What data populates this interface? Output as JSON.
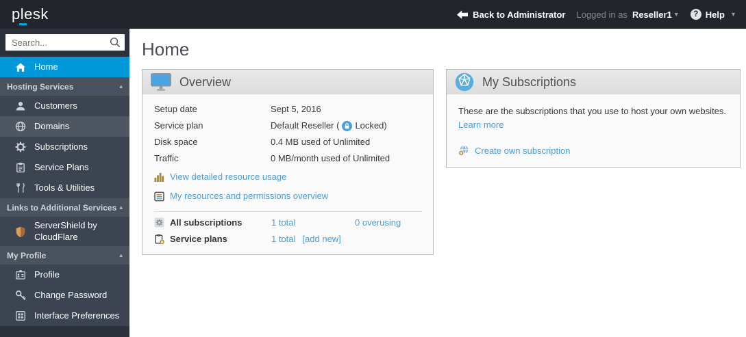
{
  "colors": {
    "topbar_bg": "#22262c",
    "accent_cyan": "#00a8e1",
    "active_item_bg": "#0098d8",
    "sidebar_bg": "#2b313b",
    "sidebar_item_bg": "#3b4450",
    "sidebar_section_bg": "#49525c",
    "link_blue": "#4a9ed8",
    "panel_header_bg": "#e4e4e4",
    "gold_icon": "#a5873d"
  },
  "glyphs": {
    "caret_down": "▾",
    "caret_up": "▴",
    "help_mark": "?"
  },
  "topbar": {
    "logo_text": "plesk",
    "back_label": "Back to Administrator",
    "logged_in_as_label": "Logged in as",
    "user_name": "Reseller1",
    "help_label": "Help"
  },
  "sidebar": {
    "search_placeholder": "Search...",
    "home_label": "Home",
    "sections": [
      {
        "label": "Hosting Services",
        "items": [
          {
            "label": "Customers"
          },
          {
            "label": "Domains"
          },
          {
            "label": "Subscriptions"
          },
          {
            "label": "Service Plans"
          },
          {
            "label": "Tools & Utilities"
          }
        ]
      },
      {
        "label": "Links to Additional Services",
        "items": [
          {
            "label": "ServerShield by CloudFlare"
          }
        ]
      },
      {
        "label": "My Profile",
        "items": [
          {
            "label": "Profile"
          },
          {
            "label": "Change Password"
          },
          {
            "label": "Interface Preferences"
          }
        ]
      }
    ]
  },
  "main": {
    "page_title": "Home",
    "overview": {
      "title": "Overview",
      "rows": [
        {
          "label": "Setup date",
          "value": "Sept 5, 2016"
        },
        {
          "label": "Service plan",
          "value_prefix": "Default Reseller (",
          "value_locked": "Locked)"
        },
        {
          "label": "Disk space",
          "value": "0.4 MB used of Unlimited"
        },
        {
          "label": "Traffic",
          "value": "0 MB/month used of Unlimited"
        }
      ],
      "links": [
        {
          "label": "View detailed resource usage"
        },
        {
          "label": "My resources and permissions overview"
        }
      ],
      "stats": [
        {
          "label": "All subscriptions",
          "total": "1 total",
          "extra": "0 overusing"
        },
        {
          "label": "Service plans",
          "total": "1 total",
          "extra": "[add new]"
        }
      ]
    },
    "my_subscriptions": {
      "title": "My Subscriptions",
      "description": "These are the subscriptions that you use to host your own websites.",
      "learn_more_label": "Learn more",
      "create_label": "Create own subscription"
    }
  }
}
